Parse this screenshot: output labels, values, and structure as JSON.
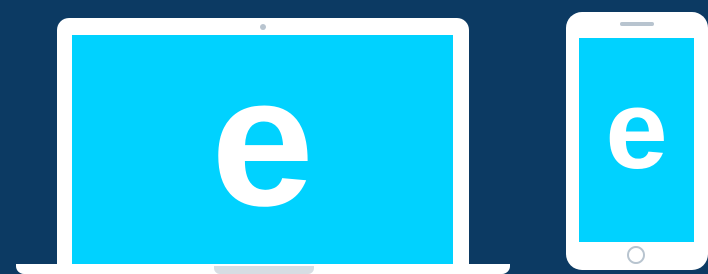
{
  "scene": {
    "background_color": "#0c3a63",
    "screen_color": "#00d2ff",
    "device_color": "#ffffff"
  },
  "laptop": {
    "logo_text": "e"
  },
  "phone": {
    "logo_text": "e"
  }
}
